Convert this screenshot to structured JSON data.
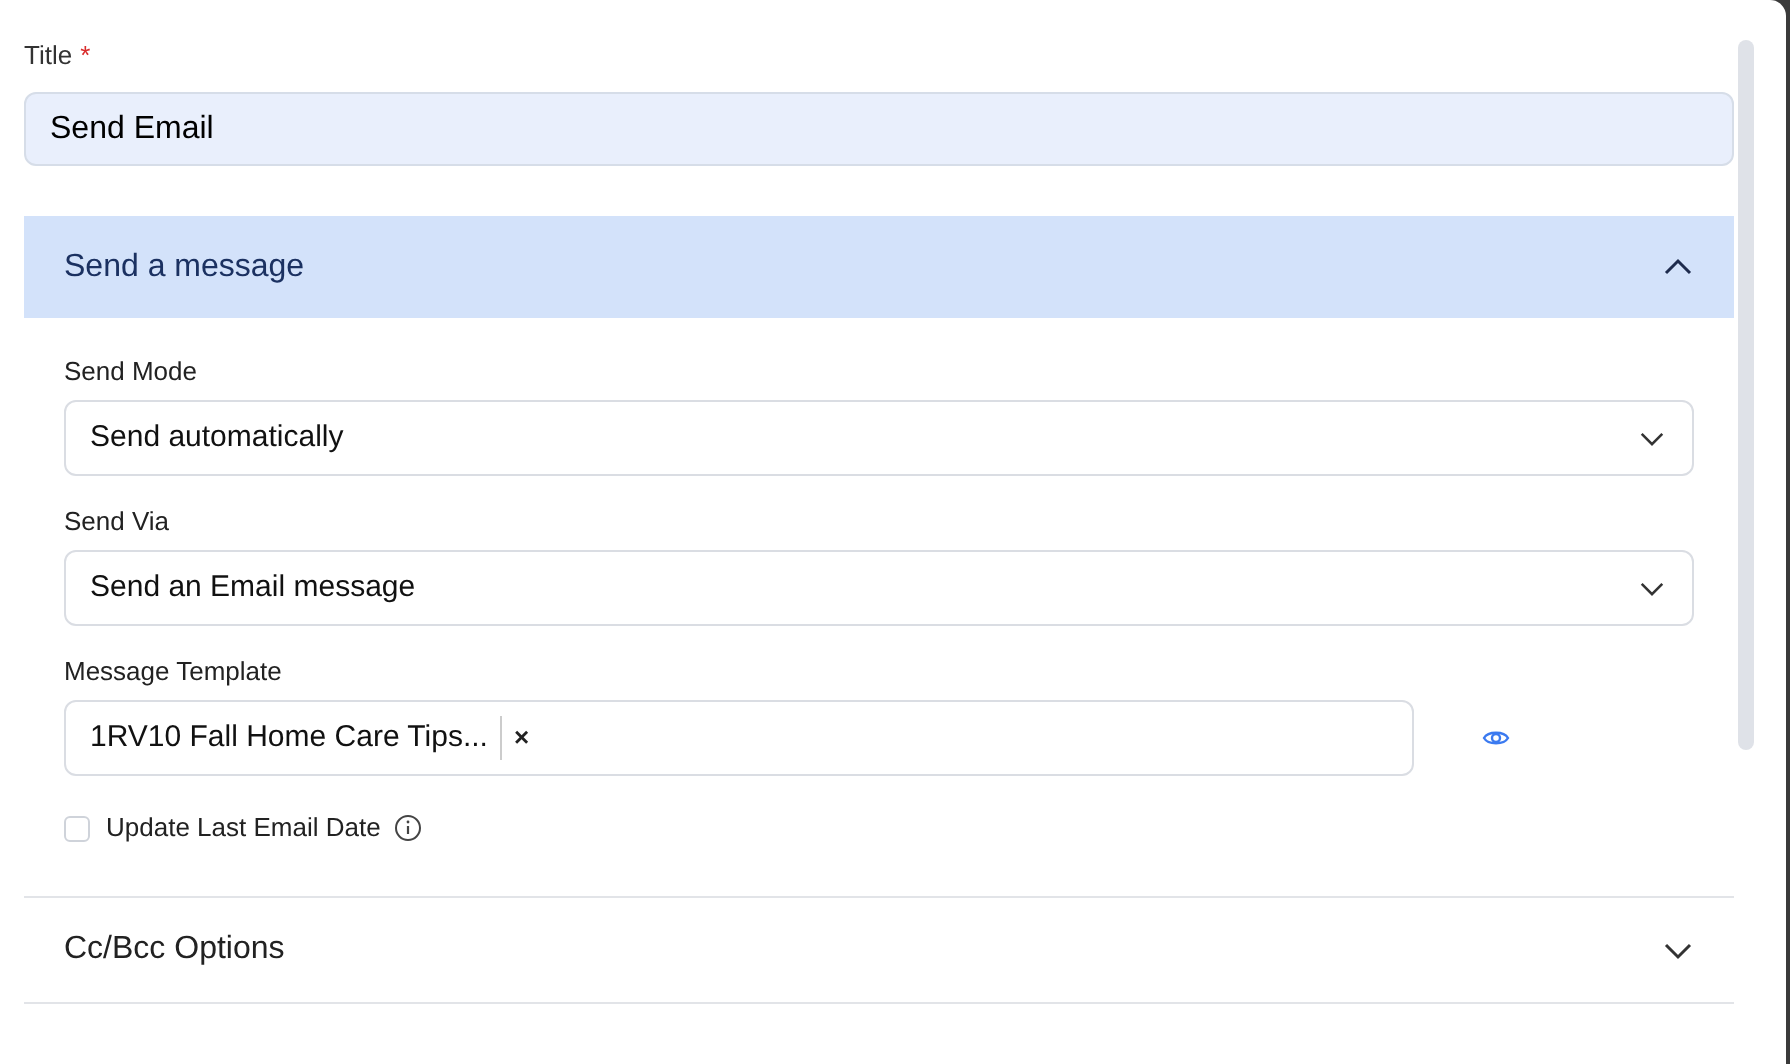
{
  "title_field": {
    "label": "Title",
    "required_mark": "*",
    "value": "Send Email"
  },
  "sections": [
    {
      "title": "Send a message",
      "expanded": true,
      "fields": [
        {
          "kind": "select",
          "label": "Send Mode",
          "value": "Send automatically"
        },
        {
          "kind": "select",
          "label": "Send Via",
          "value": "Send an Email message"
        },
        {
          "kind": "tags",
          "label": "Message Template",
          "tag": "1RV10 Fall Home Care Tips...",
          "remove": "×"
        },
        {
          "kind": "checkbox",
          "label": "Update Last Email Date",
          "checked": false
        }
      ]
    },
    {
      "title": "Cc/Bcc Options",
      "expanded": false
    }
  ]
}
